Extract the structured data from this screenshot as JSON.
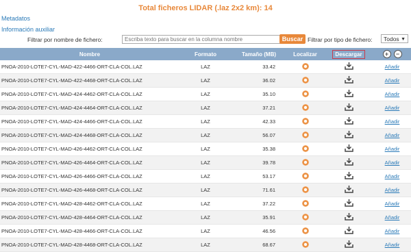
{
  "header": {
    "title": "Total ficheros  LIDAR (.laz 2x2 km): 14"
  },
  "links": {
    "metadata": "Metadatos",
    "aux_info": "Información auxiliar"
  },
  "filter": {
    "label": "Filtrar por nombre de fichero:",
    "placeholder": "Escriba texto para buscar en la columna nombre",
    "button": "Buscar",
    "type_label": "Filtrar por tipo de fichero:",
    "type_value": "Todos"
  },
  "table": {
    "headers": {
      "name": "Nombre",
      "format": "Formato",
      "size": "Tamaño (MB)",
      "locate": "Localizar",
      "download": "Descargar"
    },
    "rows": [
      {
        "name": "PNOA-2010-LOTE7-CYL-MAD-422-4466-ORT-CLA-COL.LAZ",
        "format": "LAZ",
        "size": "33.42",
        "add": "Añadir"
      },
      {
        "name": "PNOA-2010-LOTE7-CYL-MAD-422-4468-ORT-CLA-COL.LAZ",
        "format": "LAZ",
        "size": "36.02",
        "add": "Añadir"
      },
      {
        "name": "PNOA-2010-LOTE7-CYL-MAD-424-4462-ORT-CLA-COL.LAZ",
        "format": "LAZ",
        "size": "35.10",
        "add": "Añadir"
      },
      {
        "name": "PNOA-2010-LOTE7-CYL-MAD-424-4464-ORT-CLA-COL.LAZ",
        "format": "LAZ",
        "size": "37.21",
        "add": "Añadir"
      },
      {
        "name": "PNOA-2010-LOTE7-CYL-MAD-424-4466-ORT-CLA-COL.LAZ",
        "format": "LAZ",
        "size": "42.33",
        "add": "Añadir"
      },
      {
        "name": "PNOA-2010-LOTE7-CYL-MAD-424-4468-ORT-CLA-COL.LAZ",
        "format": "LAZ",
        "size": "56.07",
        "add": "Añadir"
      },
      {
        "name": "PNOA-2010-LOTE7-CYL-MAD-426-4462-ORT-CLA-COL.LAZ",
        "format": "LAZ",
        "size": "35.38",
        "add": "Añadir"
      },
      {
        "name": "PNOA-2010-LOTE7-CYL-MAD-426-4464-ORT-CLA-COL.LAZ",
        "format": "LAZ",
        "size": "39.78",
        "add": "Añadir"
      },
      {
        "name": "PNOA-2010-LOTE7-CYL-MAD-426-4466-ORT-CLA-COL.LAZ",
        "format": "LAZ",
        "size": "53.17",
        "add": "Añadir"
      },
      {
        "name": "PNOA-2010-LOTE7-CYL-MAD-426-4468-ORT-CLA-COL.LAZ",
        "format": "LAZ",
        "size": "71.61",
        "add": "Añadir"
      },
      {
        "name": "PNOA-2010-LOTE7-CYL-MAD-428-4462-ORT-CLA-COL.LAZ",
        "format": "LAZ",
        "size": "37.22",
        "add": "Añadir"
      },
      {
        "name": "PNOA-2010-LOTE7-CYL-MAD-428-4464-ORT-CLA-COL.LAZ",
        "format": "LAZ",
        "size": "35.91",
        "add": "Añadir"
      },
      {
        "name": "PNOA-2010-LOTE7-CYL-MAD-428-4466-ORT-CLA-COL.LAZ",
        "format": "LAZ",
        "size": "46.56",
        "add": "Añadir"
      },
      {
        "name": "PNOA-2010-LOTE7-CYL-MAD-428-4468-ORT-CLA-COL.LAZ",
        "format": "LAZ",
        "size": "68.67",
        "add": "Añadir"
      }
    ]
  },
  "colors": {
    "accent": "#e8883a",
    "header_bg": "#8aa9c9",
    "link": "#2a7ab8",
    "highlight": "#c83a4a"
  },
  "icons": {
    "locate": "target-icon",
    "download": "download-icon",
    "expand": "plus-circle-icon",
    "collapse": "minus-circle-icon"
  }
}
